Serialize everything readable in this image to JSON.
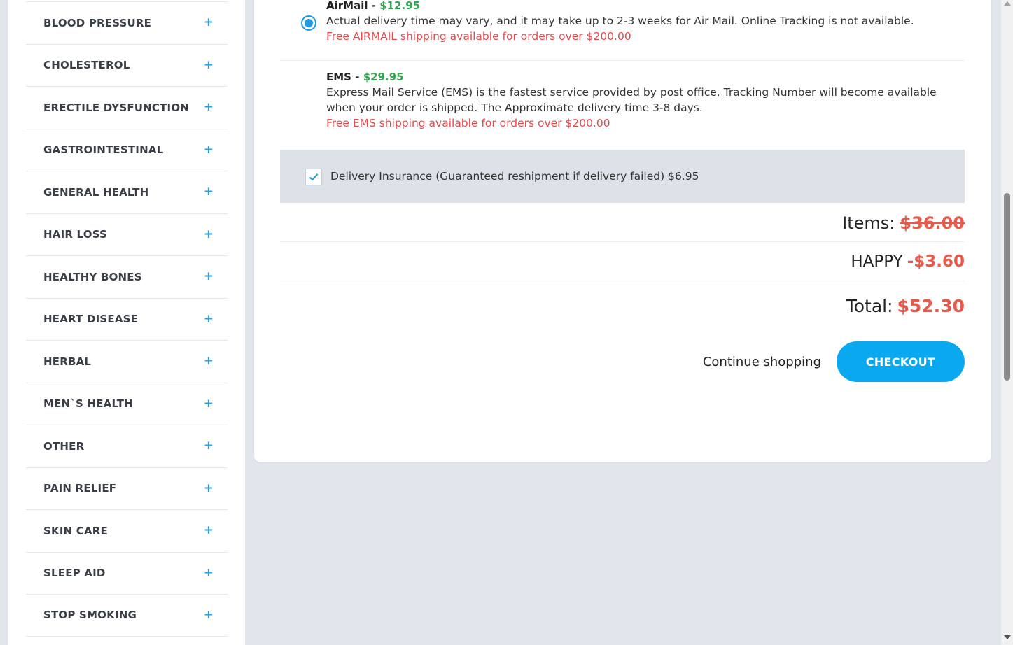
{
  "sidebar": {
    "categories": [
      "BLOOD PRESSURE",
      "CHOLESTEROL",
      "ERECTILE DYSFUNCTION",
      "GASTROINTESTINAL",
      "GENERAL HEALTH",
      "HAIR LOSS",
      "HEALTHY BONES",
      "HEART DISEASE",
      "HERBAL",
      "MEN`S HEALTH",
      "OTHER",
      "PAIN RELIEF",
      "SKIN CARE",
      "SLEEP AID",
      "STOP SMOKING"
    ],
    "expand_symbol": "+"
  },
  "shipping": {
    "airmail": {
      "name": "AirMail",
      "separator": "-",
      "price": "$12.95",
      "description": "Actual delivery time may vary, and it may take up to 2-3 weeks for Air Mail. Online Tracking is not available.",
      "free_note": "Free AIRMAIL shipping available for orders over $200.00",
      "selected": true
    },
    "ems": {
      "name": "EMS",
      "separator": "-",
      "price": "$29.95",
      "description": "Express Mail Service (EMS) is the fastest service provided by post office. Tracking Number will become available when your order is shipped. The Approximate delivery time 3-8 days.",
      "free_note": "Free EMS shipping available for orders over $200.00",
      "selected": false
    }
  },
  "insurance": {
    "label": "Delivery Insurance (Guaranteed reshipment if delivery failed) $6.95",
    "checked": true
  },
  "totals": {
    "items_label": "Items:",
    "items_value": "$36.00",
    "coupon_code": "HAPPY",
    "coupon_value": "-$3.60",
    "total_label": "Total:",
    "total_value": "$52.30"
  },
  "actions": {
    "continue_label": "Continue shopping",
    "checkout_label": "CHECKOUT"
  },
  "colors": {
    "accent": "#0aa8ee",
    "price_green": "#2fa84f",
    "alert_red": "#e8474a",
    "sidebar_plus": "#2a9fd8"
  }
}
